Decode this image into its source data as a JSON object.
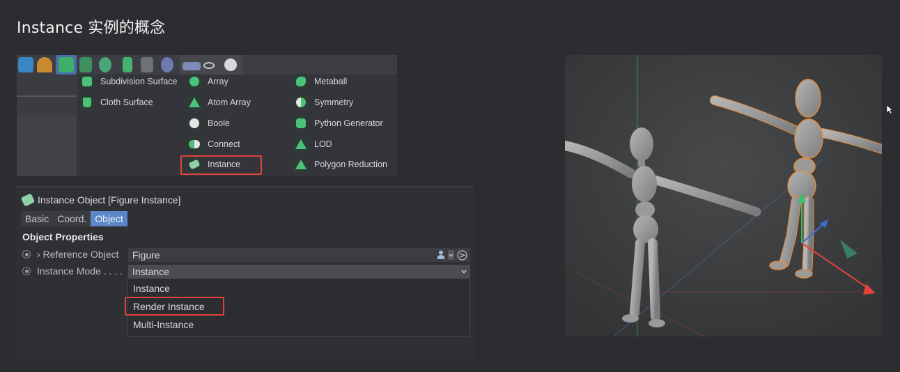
{
  "slide": {
    "title": "Instance 实例的概念"
  },
  "menu": {
    "columns": [
      {
        "items": [
          {
            "label": "Subdivision Surface",
            "icon": "subdivision-surface-icon"
          },
          {
            "label": "Cloth Surface",
            "icon": "cloth-surface-icon"
          }
        ]
      },
      {
        "items": [
          {
            "label": "Array",
            "icon": "array-icon"
          },
          {
            "label": "Atom Array",
            "icon": "atom-array-icon"
          },
          {
            "label": "Boole",
            "icon": "boole-icon"
          },
          {
            "label": "Connect",
            "icon": "connect-icon"
          },
          {
            "label": "Instance",
            "icon": "instance-icon"
          }
        ]
      },
      {
        "items": [
          {
            "label": "Metaball",
            "icon": "metaball-icon"
          },
          {
            "label": "Symmetry",
            "icon": "symmetry-icon"
          },
          {
            "label": "Python Generator",
            "icon": "python-generator-icon"
          },
          {
            "label": "LOD",
            "icon": "lod-icon"
          },
          {
            "label": "Polygon Reduction",
            "icon": "polygon-reduction-icon"
          }
        ]
      }
    ],
    "highlighted": "Instance"
  },
  "attributes": {
    "title": "Instance Object [Figure Instance]",
    "tabs": [
      {
        "label": "Basic"
      },
      {
        "label": "Coord."
      },
      {
        "label": "Object",
        "active": true
      }
    ],
    "section": "Object Properties",
    "reference_label": "› Reference Object",
    "reference_value": "Figure",
    "mode_label": "Instance Mode . . . .",
    "mode_value": "Instance",
    "mode_options": [
      "Instance",
      "Render Instance",
      "Multi-Instance"
    ],
    "highlighted_option": "Render Instance"
  },
  "colors": {
    "accent_blue": "#5b86c8",
    "highlight_red": "#e0433c",
    "icon_green": "#4ac27a",
    "selection_orange": "#e08a3c"
  }
}
